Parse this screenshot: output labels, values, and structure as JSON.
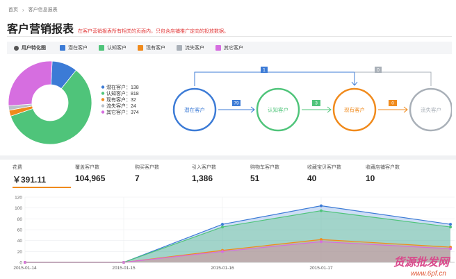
{
  "breadcrumb": {
    "home": "首页",
    "current": "客户信息报表"
  },
  "page": {
    "title": "客户营销报表",
    "note": "在客户营销报表所有相关的页面内，只包含店铺推广定向的投放数据。"
  },
  "legend": {
    "title": "用户特化图",
    "items": [
      {
        "label": "潜在客户",
        "color": "#3c7bd6"
      },
      {
        "label": "认知客户",
        "color": "#4fc47a"
      },
      {
        "label": "现有客户",
        "color": "#f08a1c"
      },
      {
        "label": "流失客户",
        "color": "#a9b0b8"
      },
      {
        "label": "其它客户",
        "color": "#d66ee0"
      }
    ]
  },
  "pie": {
    "items": [
      {
        "label": "潜在客户：138",
        "value": 138,
        "color": "#3c7bd6"
      },
      {
        "label": "认知客户：818",
        "value": 818,
        "color": "#4fc47a"
      },
      {
        "label": "现有客户：32",
        "value": 32,
        "color": "#f08a1c"
      },
      {
        "label": "流失客户：24",
        "value": 24,
        "color": "#b9c0c8"
      },
      {
        "label": "其它客户：374",
        "value": 374,
        "color": "#d66ee0"
      }
    ]
  },
  "flow": {
    "nodes": [
      {
        "label": "潜在客户",
        "color": "#3c7bd6"
      },
      {
        "label": "认知客户",
        "color": "#4fc47a"
      },
      {
        "label": "现有客户",
        "color": "#f08a1c"
      },
      {
        "label": "流失客户",
        "color": "#a9b0b8"
      }
    ],
    "arrows": [
      {
        "count": "79",
        "color": "#3c7bd6"
      },
      {
        "count": "3",
        "color": "#4fc47a"
      },
      {
        "count": "0",
        "color": "#f08a1c"
      }
    ],
    "top_counts": [
      {
        "count": "1",
        "color": "#3c7bd6"
      },
      {
        "count": "0",
        "color": "#a9b0b8"
      }
    ]
  },
  "stats": [
    {
      "label": "花费",
      "value": "￥391.11",
      "active": true
    },
    {
      "label": "覆盖客户数",
      "value": "104,965"
    },
    {
      "label": "购买客户数",
      "value": "7"
    },
    {
      "label": "引入客户数",
      "value": "1,386"
    },
    {
      "label": "购物车客户数",
      "value": "51"
    },
    {
      "label": "收藏宝贝客户数",
      "value": "40"
    },
    {
      "label": "收藏店铺客户数",
      "value": "10"
    }
  ],
  "chart_data": {
    "type": "area",
    "categories": [
      "2015-01-14",
      "2015-01-15",
      "2015-01-16",
      "2015-01-17"
    ],
    "ylim": [
      0,
      120
    ],
    "yticks": [
      0,
      20,
      40,
      60,
      80,
      100,
      120
    ],
    "series": [
      {
        "values": [
          0,
          0,
          70,
          104,
          70
        ],
        "color": "#3c7bd6"
      },
      {
        "values": [
          0,
          0,
          65,
          95,
          65
        ],
        "color": "#4fc47a"
      },
      {
        "values": [
          0,
          0,
          22,
          42,
          28
        ],
        "color": "#f08a1c"
      },
      {
        "values": [
          0,
          0,
          20,
          38,
          25
        ],
        "color": "#d66ee0"
      }
    ]
  },
  "watermark": {
    "text": "货源批发网",
    "url": "www.6pf.cn"
  }
}
